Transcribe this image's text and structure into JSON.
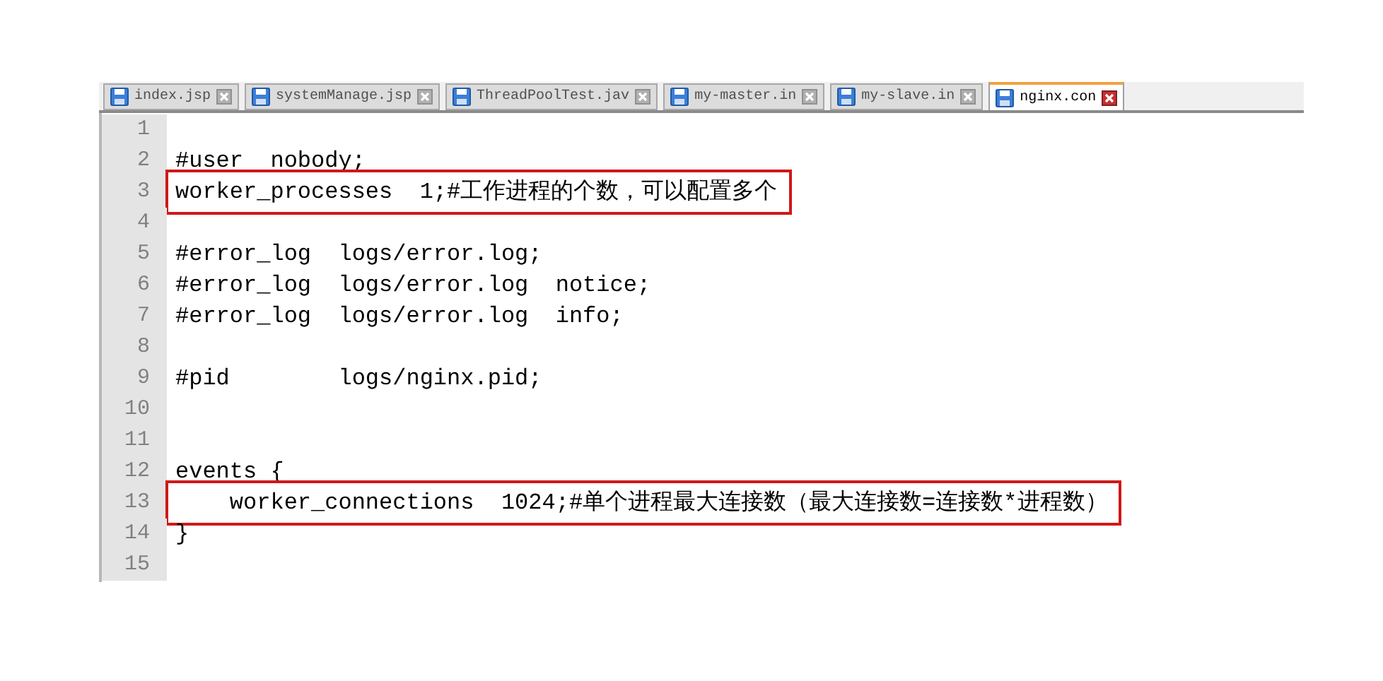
{
  "tabs": [
    {
      "label": "index.jsp",
      "selected": false
    },
    {
      "label": "systemManage.jsp",
      "selected": false
    },
    {
      "label": "ThreadPoolTest.jav",
      "selected": false
    },
    {
      "label": "my-master.in",
      "selected": false
    },
    {
      "label": "my-slave.in",
      "selected": false
    },
    {
      "label": "nginx.con",
      "selected": true
    }
  ],
  "lines": [
    {
      "number": "1",
      "highlighted": false
    },
    {
      "number": "2",
      "text": "#user  nobody;",
      "highlighted": false
    },
    {
      "number": "3",
      "text": "worker_processes  1;#工作进程的个数，可以配置多个",
      "highlighted": true
    },
    {
      "number": "4",
      "highlighted": false
    },
    {
      "number": "5",
      "text": "#error_log  logs/error.log;",
      "highlighted": false
    },
    {
      "number": "6",
      "text": "#error_log  logs/error.log  notice;",
      "highlighted": false
    },
    {
      "number": "7",
      "text": "#error_log  logs/error.log  info;",
      "highlighted": false
    },
    {
      "number": "8",
      "highlighted": false
    },
    {
      "number": "9",
      "text": "#pid        logs/nginx.pid;",
      "highlighted": false
    },
    {
      "number": "10",
      "highlighted": false
    },
    {
      "number": "11",
      "highlighted": false
    },
    {
      "number": "12",
      "text": "events {",
      "highlighted": false
    },
    {
      "number": "13",
      "text": "    worker_connections  1024;#单个进程最大连接数（最大连接数=连接数*进程数）",
      "highlighted": true
    },
    {
      "number": "14",
      "text": "}",
      "highlighted": false
    },
    {
      "number": "15",
      "highlighted": false
    }
  ]
}
